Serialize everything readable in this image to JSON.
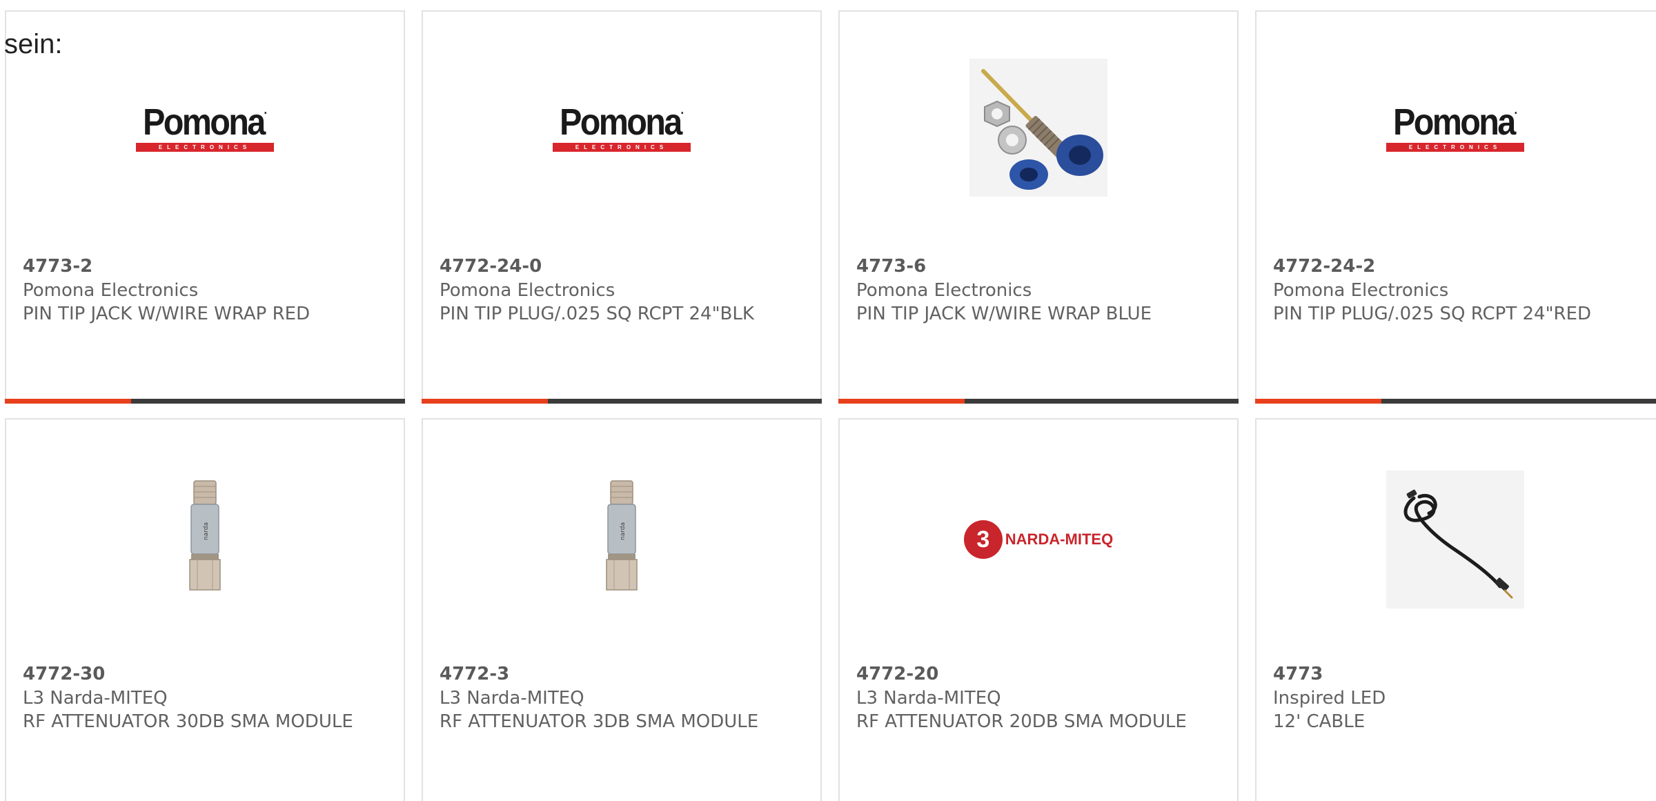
{
  "lead_text": "sein:",
  "colors": {
    "accent": "#e8401c",
    "bar": "#3b3b3b",
    "pomona_red": "#d8262d",
    "narda_red": "#c9252c"
  },
  "logos": {
    "pomona": {
      "word": "Pomona",
      "reg": ".",
      "strip": "ELECTRONICS"
    },
    "narda": {
      "badge": "3",
      "name": "NARDA-MITEQ"
    }
  },
  "cards": [
    {
      "image": "pomona-logo",
      "part_number": "4773-2",
      "manufacturer": "Pomona Electronics",
      "description": "PIN TIP JACK W/WIRE WRAP RED"
    },
    {
      "image": "pomona-logo",
      "part_number": "4772-24-0",
      "manufacturer": "Pomona Electronics",
      "description": "PIN TIP PLUG/.025 SQ RCPT 24\"BLK"
    },
    {
      "image": "pin-jack-photo",
      "part_number": "4773-6",
      "manufacturer": "Pomona Electronics",
      "description": "PIN TIP JACK W/WIRE WRAP BLUE"
    },
    {
      "image": "pomona-logo",
      "part_number": "4772-24-2",
      "manufacturer": "Pomona Electronics",
      "description": "PIN TIP PLUG/.025 SQ RCPT 24\"RED"
    },
    {
      "image": "attenuator-photo",
      "part_number": "4772-30",
      "manufacturer": "L3 Narda-MITEQ",
      "description": "RF ATTENUATOR 30DB SMA MODULE"
    },
    {
      "image": "attenuator-photo",
      "part_number": "4772-3",
      "manufacturer": "L3 Narda-MITEQ",
      "description": "RF ATTENUATOR 3DB SMA MODULE"
    },
    {
      "image": "narda-logo",
      "part_number": "4772-20",
      "manufacturer": "L3 Narda-MITEQ",
      "description": "RF ATTENUATOR 20DB SMA MODULE"
    },
    {
      "image": "cable-photo",
      "part_number": "4773",
      "manufacturer": "Inspired LED",
      "description": "12' CABLE"
    }
  ]
}
